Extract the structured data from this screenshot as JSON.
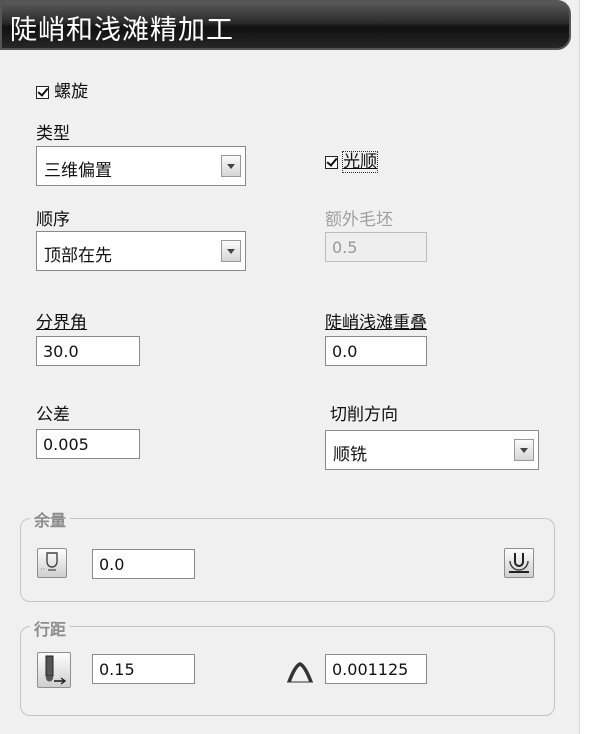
{
  "title": "陡峭和浅滩精加工",
  "spiral": {
    "label": "螺旋",
    "checked": true
  },
  "type": {
    "label": "类型",
    "value": "三维偏置"
  },
  "smooth": {
    "label": "光顺",
    "checked": true
  },
  "order": {
    "label": "顺序",
    "value": "顶部在先"
  },
  "extra_stock": {
    "label": "额外毛坯",
    "value": "0.5"
  },
  "threshold_angle": {
    "label": "分界角",
    "value": "30.0"
  },
  "overlap": {
    "label": "陡峭浅滩重叠",
    "value": "0.0"
  },
  "tolerance": {
    "label": "公差",
    "value": "0.005"
  },
  "cut_direction": {
    "label": "切削方向",
    "value": "顺铣"
  },
  "allowance": {
    "label": "余量",
    "value": "0.0"
  },
  "stepover": {
    "label": "行距",
    "value": "0.15",
    "cusp_value": "0.001125"
  },
  "icons": [
    "component-allowance-icon",
    "allowance-options-icon",
    "stepover-tool-icon",
    "cusp-height-icon"
  ]
}
